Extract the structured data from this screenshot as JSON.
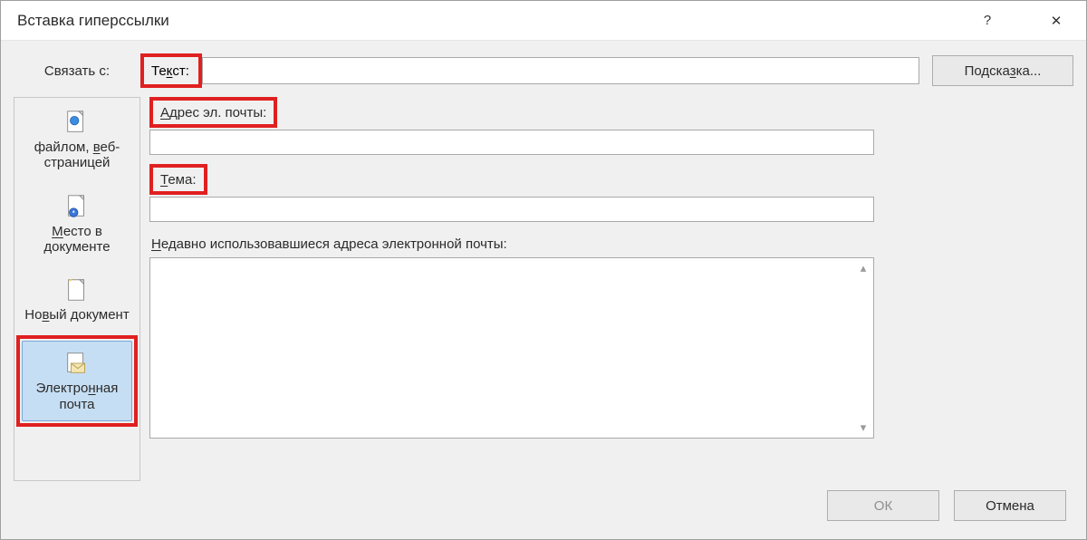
{
  "dialog": {
    "title": "Вставка гиперссылки",
    "help_icon": "?",
    "close_icon": "✕"
  },
  "linkwith": {
    "label": "Связать с:"
  },
  "text_field": {
    "label_pre": "Те",
    "label_ul": "к",
    "label_post": "ст:",
    "value": ""
  },
  "hint_button": {
    "label": "Подска",
    "label_ul": "з",
    "label_post": "ка..."
  },
  "sidebar": {
    "items": [
      {
        "label_pre": "файлом, ",
        "label_ul": "в",
        "label_post": "еб-страницей"
      },
      {
        "label_ul": "М",
        "label_post": "есто в документе",
        "label_pre": ""
      },
      {
        "label_pre": "Но",
        "label_ul": "в",
        "label_post": "ый документ"
      },
      {
        "label_pre": "Электро",
        "label_ul": "н",
        "label_post": "ная почта"
      }
    ]
  },
  "email": {
    "address_label_ul": "А",
    "address_label_post": "дрес эл. почты:",
    "address_value": "",
    "subject_label_ul": "Т",
    "subject_label_post": "ема:",
    "subject_value": "",
    "recent_label_ul": "Н",
    "recent_label_post": "едавно использовавшиеся адреса электронной почты:"
  },
  "footer": {
    "ok": "ОК",
    "cancel": "Отмена"
  }
}
